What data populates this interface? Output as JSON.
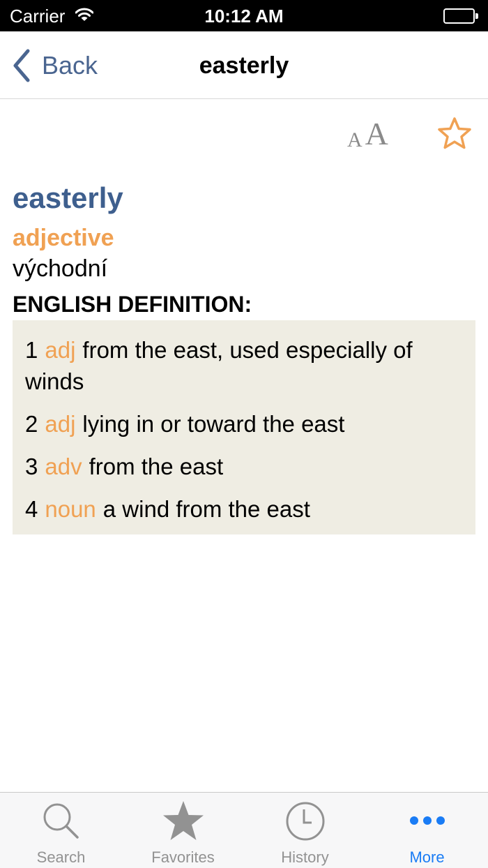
{
  "status_bar": {
    "carrier": "Carrier",
    "time": "10:12 AM"
  },
  "nav": {
    "back_label": "Back",
    "title": "easterly"
  },
  "tools": {
    "font_small": "A",
    "font_large": "A",
    "favorite_icon": "star-outline-icon"
  },
  "entry": {
    "headword": "easterly",
    "part_of_speech": "adjective",
    "translation": "východní",
    "definition_header": "ENGLISH DEFINITION:",
    "definitions": [
      {
        "num": "1",
        "tag": "adj",
        "text": "from the east, used especially of winds"
      },
      {
        "num": "2",
        "tag": "adj",
        "text": "lying in or toward the east"
      },
      {
        "num": "3",
        "tag": "adv",
        "text": "from the east"
      },
      {
        "num": "4",
        "tag": "noun",
        "text": "a wind from the east"
      }
    ]
  },
  "tabs": [
    {
      "label": "Search",
      "icon": "magnifier-icon",
      "active": false
    },
    {
      "label": "Favorites",
      "icon": "star-icon",
      "active": false
    },
    {
      "label": "History",
      "icon": "clock-icon",
      "active": false
    },
    {
      "label": "More",
      "icon": "more-dots-icon",
      "active": true
    }
  ],
  "colors": {
    "headword": "#3e5f8e",
    "accent_orange": "#f0a153",
    "definition_bg": "#efede3",
    "tab_active": "#1a7cf5",
    "tab_inactive": "#929292"
  }
}
